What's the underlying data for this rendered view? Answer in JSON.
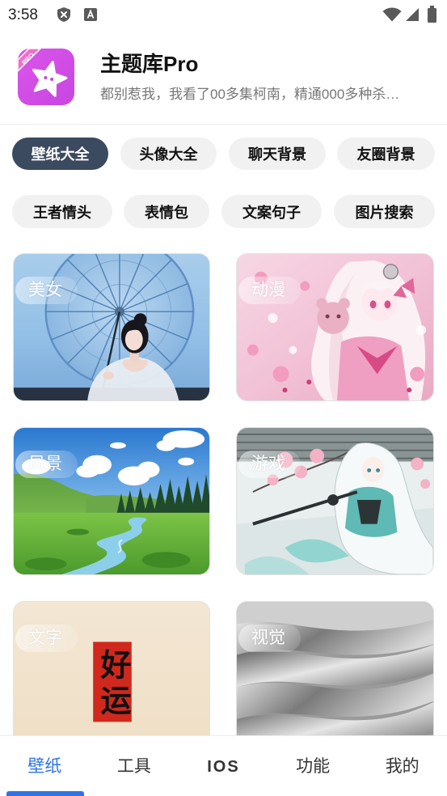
{
  "status_bar": {
    "time": "3:58",
    "left_icons": [
      "shield-x-icon",
      "font-a-icon"
    ],
    "right_icons": [
      "wifi-icon",
      "cell-signal-icon",
      "battery-icon"
    ]
  },
  "app_header": {
    "title": "主题库Pro",
    "subtitle": "都别惹我，我看了00多集柯南，精通000多种杀…",
    "logo": {
      "icon": "star-icon",
      "badge": "PRO"
    }
  },
  "categories": {
    "row1": [
      {
        "label": "壁纸大全",
        "selected": true
      },
      {
        "label": "头像大全",
        "selected": false
      },
      {
        "label": "聊天背景",
        "selected": false
      },
      {
        "label": "友圈背景",
        "selected": false
      }
    ],
    "row2": [
      {
        "label": "王者情头",
        "selected": false
      },
      {
        "label": "表情包",
        "selected": false
      },
      {
        "label": "文案句子",
        "selected": false
      },
      {
        "label": "图片搜索",
        "selected": false
      }
    ]
  },
  "gallery": [
    {
      "label": "美女"
    },
    {
      "label": "动漫"
    },
    {
      "label": "风景"
    },
    {
      "label": "游戏"
    },
    {
      "label": "文字",
      "art_text": "好运"
    },
    {
      "label": "视觉"
    }
  ],
  "bottom_nav": {
    "items": [
      {
        "label": "壁纸",
        "active": true
      },
      {
        "label": "工具",
        "active": false
      },
      {
        "label": "IOS",
        "active": false
      },
      {
        "label": "功能",
        "active": false
      },
      {
        "label": "我的",
        "active": false
      }
    ]
  },
  "colors": {
    "accent": "#2f74e6",
    "chip_selected_bg": "#3b4a5e",
    "chip_bg": "#f1f1f1",
    "text_primary": "#111111",
    "text_secondary": "#777777",
    "nav_text": "#333333"
  }
}
